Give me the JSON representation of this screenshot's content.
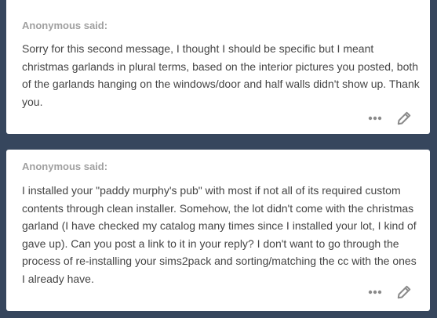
{
  "asks": [
    {
      "asker_label": "Anonymous said:",
      "message": "Sorry for this second message, I thought I should be specific but I meant christmas garlands in plural terms, based on the interior pictures you posted, both of the garlands hanging on the windows/door and half walls didn't show up. Thank you.",
      "actions": [
        "more-icon",
        "edit-icon"
      ]
    },
    {
      "asker_label": "Anonymous said:",
      "message": "I installed your \"paddy murphy's pub\" with most if not all of its required custom contents through clean installer. Somehow, the lot didn't come with the christmas garland (I have checked my catalog many times since I installed your lot, I kind of gave up). Can you post a link to it in your reply? I don't want to go through the process of re-installing your sims2pack and sorting/matching the cc with the ones I already have.",
      "actions": [
        "more-icon",
        "edit-icon"
      ]
    }
  ],
  "colors": {
    "page_background": "#36465d",
    "card_background": "#ffffff",
    "asker_text": "#a0a0a0",
    "message_text": "#444444",
    "icon": "#8a8a8a"
  }
}
